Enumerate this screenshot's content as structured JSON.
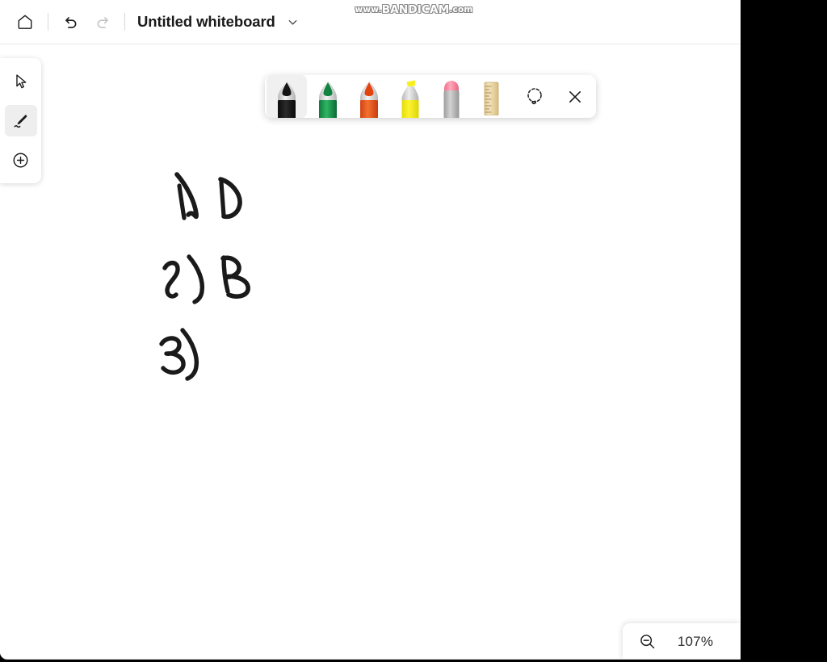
{
  "app": {
    "title": "Untitled whiteboard",
    "background_color": "#ffffff",
    "outside_color": "#000000"
  },
  "watermark": {
    "prefix": "www.",
    "brand": "BANDICAM",
    "suffix": ".com"
  },
  "titlebar": {
    "home_label": "Home",
    "undo_label": "Undo",
    "redo_label": "Redo",
    "redo_disabled": true,
    "title_menu_label": "Untitled whiteboard"
  },
  "rail": {
    "items": [
      {
        "name": "select",
        "label": "Select",
        "active": false
      },
      {
        "name": "ink",
        "label": "Ink",
        "active": true
      },
      {
        "name": "create",
        "label": "Create",
        "active": false
      }
    ]
  },
  "pen_toolbar": {
    "tools": [
      {
        "name": "black-pen",
        "label": "Pen, black",
        "selected": true,
        "body": "#191919",
        "tip": "#d8d8d8",
        "nib": "#161616"
      },
      {
        "name": "green-pen",
        "label": "Pen, green",
        "selected": false,
        "body": "#179a4e",
        "tip": "#dcdcdc",
        "nib": "#0d7a3b"
      },
      {
        "name": "red-pen",
        "label": "Pen, red",
        "selected": false,
        "body": "#ef5a1c",
        "tip": "#dcdcdc",
        "nib": "#d8401a"
      },
      {
        "name": "yellow-highlighter",
        "label": "Highlighter, yellow",
        "selected": false,
        "body": "#f2ea0b",
        "tip": "#c9c9c9",
        "nib": "#f2ea0b"
      },
      {
        "name": "eraser",
        "label": "Eraser",
        "selected": false,
        "body": "#b9b9b9",
        "tip": "#b9b9b9",
        "nib": "#f3889f"
      }
    ],
    "icon_tools": [
      {
        "name": "ruler",
        "label": "Ruler",
        "color": "#e8d5a3"
      },
      {
        "name": "lasso",
        "label": "Lasso select",
        "color": "#1a1a1a"
      },
      {
        "name": "close",
        "label": "Close",
        "color": "#1a1a1a"
      }
    ]
  },
  "canvas": {
    "ink_color": "#1a1a1a",
    "strokes": [
      {
        "name": "item-1-number",
        "text": "1)"
      },
      {
        "name": "item-1-answer",
        "text": "D"
      },
      {
        "name": "item-2-number",
        "text": "2)"
      },
      {
        "name": "item-2-answer",
        "text": "B"
      },
      {
        "name": "item-3-number",
        "text": "3)"
      }
    ]
  },
  "zoom": {
    "level": "107%",
    "zoom_out_label": "Zoom out"
  }
}
